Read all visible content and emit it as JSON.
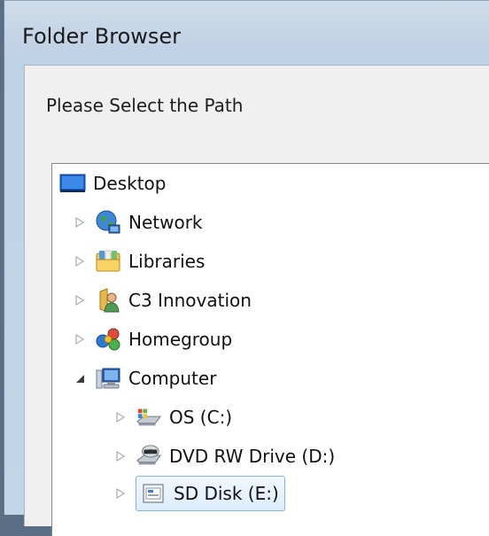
{
  "window": {
    "title": "Folder Browser"
  },
  "dialog": {
    "prompt": "Please Select the Path"
  },
  "tree": {
    "items": [
      {
        "label": "Desktop",
        "icon": "desktop-icon",
        "expander": "none"
      },
      {
        "label": "Network",
        "icon": "network-icon",
        "expander": "collapsed"
      },
      {
        "label": "Libraries",
        "icon": "libraries-icon",
        "expander": "collapsed"
      },
      {
        "label": "C3 Innovation",
        "icon": "user-folder-icon",
        "expander": "collapsed"
      },
      {
        "label": "Homegroup",
        "icon": "homegroup-icon",
        "expander": "collapsed"
      },
      {
        "label": "Computer",
        "icon": "computer-icon",
        "expander": "expanded"
      },
      {
        "label": "OS (C:)",
        "icon": "os-drive-icon",
        "expander": "collapsed"
      },
      {
        "label": "DVD RW Drive (D:)",
        "icon": "dvd-drive-icon",
        "expander": "collapsed"
      },
      {
        "label": "SD Disk (E:)",
        "icon": "sd-disk-icon",
        "expander": "collapsed",
        "selected": true
      }
    ]
  },
  "colors": {
    "selection_border": "#7eb4ea",
    "selection_fill": "#dcecfc"
  }
}
